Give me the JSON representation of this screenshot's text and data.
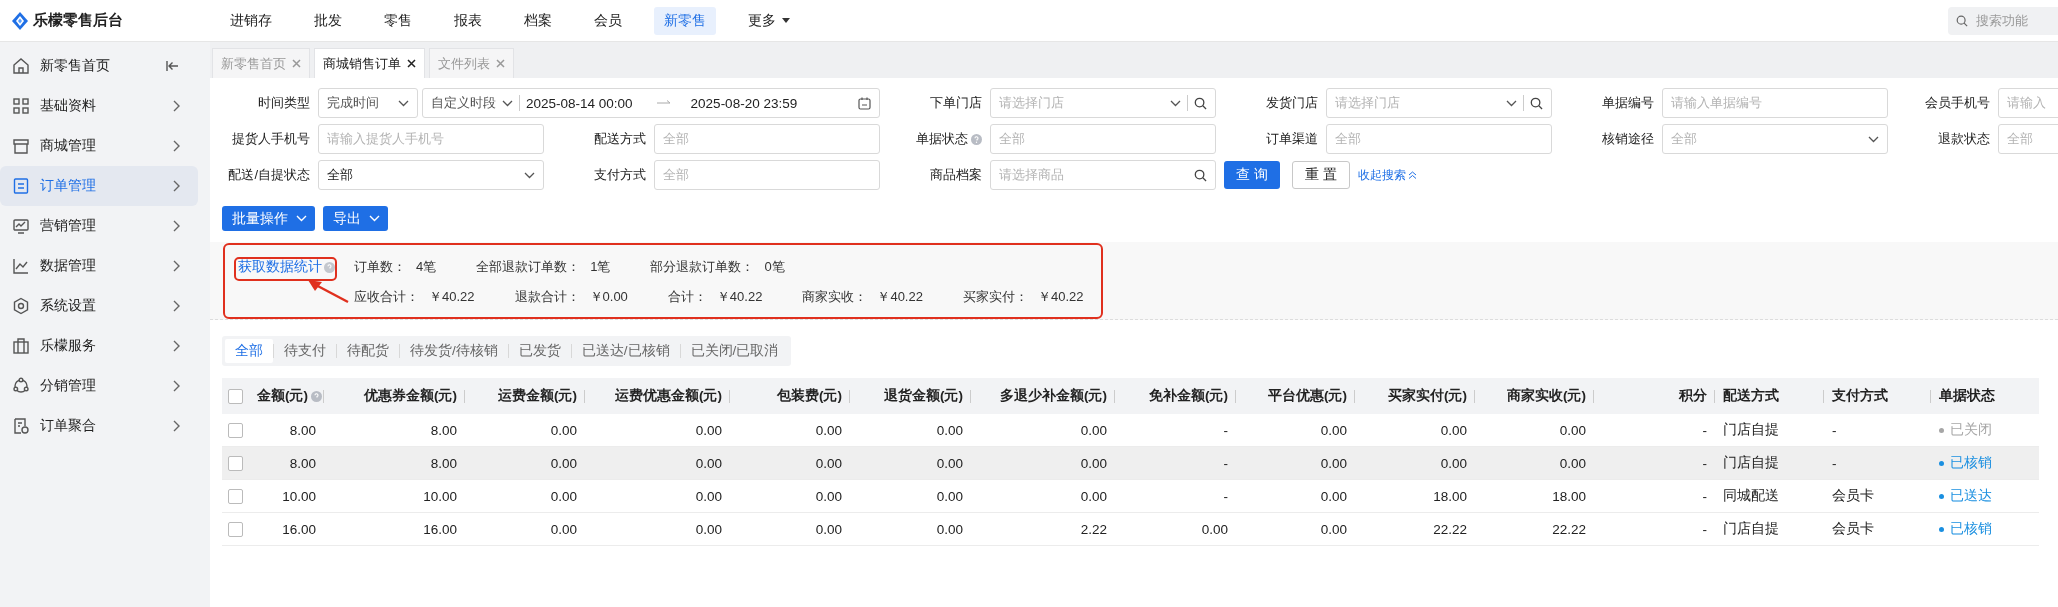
{
  "app": {
    "title": "乐檬零售后台"
  },
  "top_nav": [
    {
      "label": "进销存",
      "selected": false,
      "dropdown": false
    },
    {
      "label": "批发",
      "selected": false,
      "dropdown": false
    },
    {
      "label": "零售",
      "selected": false,
      "dropdown": false
    },
    {
      "label": "报表",
      "selected": false,
      "dropdown": false
    },
    {
      "label": "档案",
      "selected": false,
      "dropdown": false
    },
    {
      "label": "会员",
      "selected": false,
      "dropdown": false
    },
    {
      "label": "新零售",
      "selected": true,
      "dropdown": false
    },
    {
      "label": "更多",
      "selected": false,
      "dropdown": true
    }
  ],
  "search": {
    "placeholder": "搜索功能"
  },
  "sidebar": {
    "items": [
      {
        "label": "新零售首页",
        "selected": false,
        "kind": "home"
      },
      {
        "label": "基础资料",
        "selected": false,
        "kind": "section"
      },
      {
        "label": "商城管理",
        "selected": false,
        "kind": "section"
      },
      {
        "label": "订单管理",
        "selected": true,
        "kind": "section"
      },
      {
        "label": "营销管理",
        "selected": false,
        "kind": "section"
      },
      {
        "label": "数据管理",
        "selected": false,
        "kind": "section"
      },
      {
        "label": "系统设置",
        "selected": false,
        "kind": "section"
      },
      {
        "label": "乐檬服务",
        "selected": false,
        "kind": "section"
      },
      {
        "label": "分销管理",
        "selected": false,
        "kind": "section"
      },
      {
        "label": "订单聚合",
        "selected": false,
        "kind": "section"
      }
    ]
  },
  "page_tabs": [
    {
      "label": "新零售首页",
      "selected": false
    },
    {
      "label": "商城销售订单",
      "selected": true
    },
    {
      "label": "文件列表",
      "selected": false
    }
  ],
  "filters": {
    "fields": [
      {
        "kind": "time_range",
        "label": "时间类型",
        "type_value": "完成时间",
        "period_value": "自定义时段",
        "start": "2025-08-14 00:00",
        "end": "2025-08-20 23:59"
      },
      {
        "kind": "search_select",
        "label": "下单门店",
        "placeholder": "请选择门店"
      },
      {
        "kind": "search_select",
        "label": "发货门店",
        "placeholder": "请选择门店"
      },
      {
        "kind": "input",
        "label": "单据编号",
        "placeholder": "请输入单据编号"
      },
      {
        "kind": "input",
        "label": "会员手机号",
        "placeholder": "请输入"
      },
      {
        "kind": "input",
        "label": "提货人手机号",
        "placeholder": "请输入提货人手机号"
      },
      {
        "kind": "input",
        "label": "配送方式",
        "placeholder": "全部"
      },
      {
        "kind": "input",
        "label": "单据状态",
        "placeholder": "全部",
        "help": true
      },
      {
        "kind": "input",
        "label": "订单渠道",
        "placeholder": "全部"
      },
      {
        "kind": "select",
        "label": "核销途径",
        "placeholder": "全部"
      },
      {
        "kind": "input",
        "label": "退款状态",
        "placeholder": "全部"
      },
      {
        "kind": "select",
        "label": "配送/自提状态",
        "value": "全部"
      },
      {
        "kind": "input",
        "label": "支付方式",
        "placeholder": "全部"
      },
      {
        "kind": "search_input",
        "label": "商品档案",
        "placeholder": "请选择商品"
      }
    ],
    "query_button": "查 询",
    "reset_button": "重 置",
    "collapse_link": "收起搜索"
  },
  "actions": [
    {
      "label": "批量操作"
    },
    {
      "label": "导出"
    }
  ],
  "stats": {
    "link": "获取数据统计",
    "row_1": [
      {
        "label": "订单数：",
        "value": "4笔"
      },
      {
        "label": "全部退款订单数：",
        "value": "1笔"
      },
      {
        "label": "部分退款订单数：",
        "value": "0笔"
      }
    ],
    "row_2": [
      {
        "label": "应收合计：",
        "value": "￥40.22"
      },
      {
        "label": "退款合计：",
        "value": "￥0.00"
      },
      {
        "label": "合计：",
        "value": "￥40.22"
      },
      {
        "label": "商家实收：",
        "value": "￥40.22"
      },
      {
        "label": "买家实付：",
        "value": "￥40.22"
      }
    ]
  },
  "status_tabs": [
    {
      "label": "全部",
      "selected": true
    },
    {
      "label": "待支付",
      "selected": false
    },
    {
      "label": "待配货",
      "selected": false
    },
    {
      "label": "待发货/待核销",
      "selected": false
    },
    {
      "label": "已发货",
      "selected": false
    },
    {
      "label": "已送达/已核销",
      "selected": false
    },
    {
      "label": "已关闭/已取消",
      "selected": false
    }
  ],
  "table": {
    "all_checked": false,
    "columns": [
      {
        "label": "金额(元)",
        "help": true
      },
      {
        "label": "优惠券金额(元)"
      },
      {
        "label": "运费金额(元)"
      },
      {
        "label": "运费优惠金额(元)"
      },
      {
        "label": "包装费(元)"
      },
      {
        "label": "退货金额(元)"
      },
      {
        "label": "多退少补金额(元)"
      },
      {
        "label": "免补金额(元)"
      },
      {
        "label": "平台优惠(元)"
      },
      {
        "label": "买家实付(元)"
      },
      {
        "label": "商家实收(元)"
      },
      {
        "label": "积分"
      },
      {
        "label": "配送方式"
      },
      {
        "label": "支付方式"
      },
      {
        "label": "单据状态"
      }
    ],
    "rows": [
      {
        "checked": false,
        "hovered": false,
        "cells": [
          "8.00",
          "8.00",
          "0.00",
          "0.00",
          "0.00",
          "0.00",
          "0.00",
          "-",
          "0.00",
          "0.00",
          "0.00",
          "-",
          "门店自提",
          "-"
        ],
        "status": {
          "text": "已关闭",
          "color": "#a6a6a6"
        }
      },
      {
        "checked": false,
        "hovered": true,
        "cells": [
          "8.00",
          "8.00",
          "0.00",
          "0.00",
          "0.00",
          "0.00",
          "0.00",
          "-",
          "0.00",
          "0.00",
          "0.00",
          "-",
          "门店自提",
          "-"
        ],
        "status": {
          "text": "已核销",
          "color": "#1a8fe0"
        }
      },
      {
        "checked": false,
        "hovered": false,
        "cells": [
          "10.00",
          "10.00",
          "0.00",
          "0.00",
          "0.00",
          "0.00",
          "0.00",
          "-",
          "0.00",
          "18.00",
          "18.00",
          "-",
          "同城配送",
          "会员卡"
        ],
        "status": {
          "text": "已送达",
          "color": "#1a8fe0"
        }
      },
      {
        "checked": false,
        "hovered": false,
        "cells": [
          "16.00",
          "16.00",
          "0.00",
          "0.00",
          "0.00",
          "0.00",
          "2.22",
          "0.00",
          "0.00",
          "22.22",
          "22.22",
          "-",
          "门店自提",
          "会员卡"
        ],
        "status": {
          "text": "已核销",
          "color": "#1a8fe0"
        }
      }
    ]
  }
}
